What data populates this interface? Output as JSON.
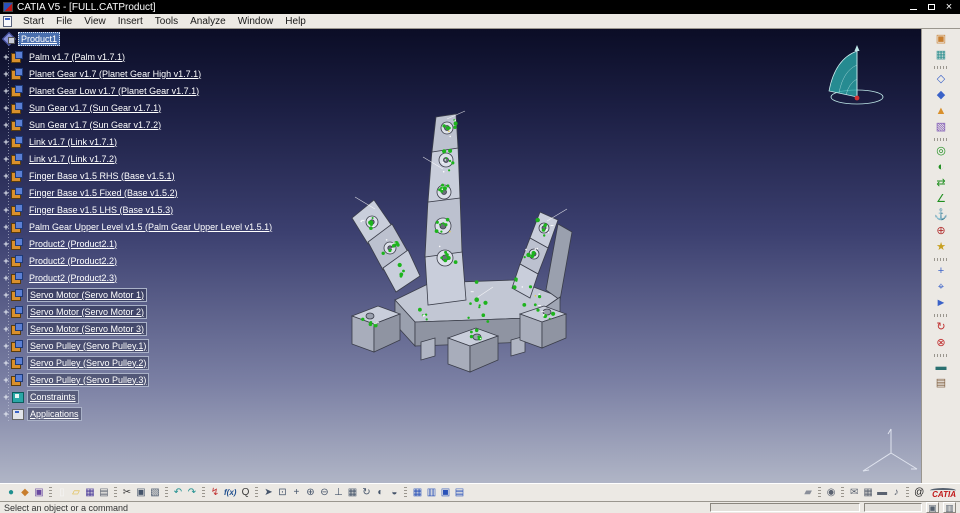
{
  "window": {
    "title": "CATIA V5 - [FULL.CATProduct]"
  },
  "menu": {
    "items": [
      "Start",
      "File",
      "View",
      "Insert",
      "Tools",
      "Analyze",
      "Window",
      "Help"
    ]
  },
  "tree": {
    "expander_glyph": "+",
    "root": {
      "label": "Product1",
      "selected": true
    },
    "items": [
      {
        "label": "Palm v1.7 (Palm v1.7.1)"
      },
      {
        "label": "Planet Gear v1.7 (Planet Gear High v1.7.1)"
      },
      {
        "label": "Planet Gear Low v1.7 (Planet Gear v1.7.1)"
      },
      {
        "label": "Sun Gear v1.7 (Sun Gear v1.7.1)"
      },
      {
        "label": "Sun Gear v1.7 (Sun Gear v1.7.2)"
      },
      {
        "label": "Link v1.7 (Link v1.7.1)"
      },
      {
        "label": "Link v1.7 (Link v1.7.2)"
      },
      {
        "label": "Finger Base v1.5 RHS (Base v1.5.1)"
      },
      {
        "label": "Finger Base v1.5 Fixed (Base v1.5.2)"
      },
      {
        "label": "Finger Base v1.5 LHS (Base v1.5.3)"
      },
      {
        "label": "Palm Gear Upper Level v1.5 (Palm Gear Upper Level v1.5.1)"
      },
      {
        "label": "Product2 (Product2.1)"
      },
      {
        "label": "Product2 (Product2.2)"
      },
      {
        "label": "Product2 (Product2.3)"
      },
      {
        "label": "Servo Motor (Servo Motor 1)",
        "boxed": true
      },
      {
        "label": "Servo Motor (Servo Motor 2)",
        "boxed": true
      },
      {
        "label": "Servo Motor (Servo Motor 3)",
        "boxed": true
      },
      {
        "label": "Servo Pulley (Servo Pulley.1)",
        "boxed": true
      },
      {
        "label": "Servo Pulley (Servo Pulley.2)",
        "boxed": true
      },
      {
        "label": "Servo Pulley (Servo Pulley.3)",
        "boxed": true
      },
      {
        "label": "Constraints",
        "type": "constraints",
        "boxed": true
      },
      {
        "label": "Applications",
        "type": "applications",
        "boxed": true
      }
    ]
  },
  "right_toolbar": {
    "icons": [
      {
        "name": "sticky-pad-icon",
        "glyph": "▣",
        "color": "#c87e2e"
      },
      {
        "name": "camera-window-icon",
        "glyph": "▦",
        "color": "#2a8f8f"
      },
      {
        "sep": true
      },
      {
        "name": "component-icon",
        "glyph": "◇",
        "color": "#3a62c8"
      },
      {
        "name": "product-icon",
        "glyph": "◆",
        "color": "#3a62c8"
      },
      {
        "name": "part-icon",
        "glyph": "▲",
        "color": "#d9902c"
      },
      {
        "name": "existing-component-icon",
        "glyph": "▧",
        "color": "#7a52b4"
      },
      {
        "sep": true
      },
      {
        "name": "coincidence-constraint-icon",
        "glyph": "◎",
        "color": "#1f8f1f"
      },
      {
        "name": "contact-constraint-icon",
        "glyph": "◐",
        "color": "#1f8f1f"
      },
      {
        "name": "offset-constraint-icon",
        "glyph": "⇄",
        "color": "#1f8f1f"
      },
      {
        "name": "angle-constraint-icon",
        "glyph": "∠",
        "color": "#1f8f1f"
      },
      {
        "name": "anchor-constraint-icon",
        "glyph": "⚓",
        "color": "#b23030"
      },
      {
        "name": "fix-together-icon",
        "glyph": "⊕",
        "color": "#b23030"
      },
      {
        "name": "quick-constraint-icon",
        "glyph": "★",
        "color": "#c8a020"
      },
      {
        "sep": true
      },
      {
        "name": "manipulation-icon",
        "glyph": "+",
        "color": "#3a62c8"
      },
      {
        "name": "snap-icon",
        "glyph": "⌖",
        "color": "#3a62c8"
      },
      {
        "name": "smart-move-icon",
        "glyph": "►",
        "color": "#3a62c8"
      },
      {
        "sep": true
      },
      {
        "name": "update-assembly-icon",
        "glyph": "↻",
        "color": "#c03030"
      },
      {
        "name": "clash-analysis-icon",
        "glyph": "⊗",
        "color": "#c03030"
      },
      {
        "sep": true
      },
      {
        "name": "measure-icon",
        "glyph": "▬",
        "color": "#2a7070"
      },
      {
        "name": "annotations-icon",
        "glyph": "▤",
        "color": "#806040"
      }
    ]
  },
  "bottom_toolbar": {
    "logo": "CATIA",
    "left_icons": [
      {
        "name": "workbench-icon",
        "glyph": "●",
        "color": "#1f8f8f"
      },
      {
        "name": "macros-icon",
        "glyph": "◆",
        "color": "#c87e2e"
      },
      {
        "name": "options-icon",
        "glyph": "▣",
        "color": "#6a4aa0"
      },
      {
        "sep": true
      },
      {
        "name": "new-document-icon",
        "glyph": "▯",
        "color": "#f5f5f5"
      },
      {
        "name": "open-document-icon",
        "glyph": "▱",
        "color": "#e0b83a"
      },
      {
        "name": "save-icon",
        "glyph": "▦",
        "color": "#4a3a9a"
      },
      {
        "name": "print-icon",
        "glyph": "▤",
        "color": "#5a6270"
      },
      {
        "sep": true
      },
      {
        "name": "cut-icon",
        "glyph": "✂",
        "color": "#3a3a3a"
      },
      {
        "name": "copy-icon",
        "glyph": "▣",
        "color": "#45546a"
      },
      {
        "name": "paste-icon",
        "glyph": "▧",
        "color": "#45546a"
      },
      {
        "sep": true
      },
      {
        "name": "undo-icon",
        "glyph": "↶",
        "color": "#1f8f8f"
      },
      {
        "name": "redo-icon",
        "glyph": "↷",
        "color": "#1f8f8f"
      },
      {
        "sep": true
      },
      {
        "name": "update-icon",
        "glyph": "↯",
        "color": "#c03030"
      },
      {
        "name": "knowledge-fx-icon",
        "glyph": "f(x)",
        "color": "#1f4f8f",
        "wide": true
      },
      {
        "name": "search-icon",
        "glyph": "Q",
        "color": "#3a3a3a"
      },
      {
        "sep": true
      },
      {
        "name": "fly-mode-icon",
        "glyph": "➤",
        "color": "#45546a"
      },
      {
        "name": "fit-all-icon",
        "glyph": "⊡",
        "color": "#45546a"
      },
      {
        "name": "pan-icon",
        "glyph": "+",
        "color": "#45546a"
      },
      {
        "name": "zoom-in-icon",
        "glyph": "⊕",
        "color": "#45546a"
      },
      {
        "name": "zoom-out-icon",
        "glyph": "⊖",
        "color": "#45546a"
      },
      {
        "name": "normal-view-icon",
        "glyph": "⊥",
        "color": "#45546a"
      },
      {
        "name": "multi-view-icon",
        "glyph": "▦",
        "color": "#45546a"
      },
      {
        "name": "rotate-view-icon",
        "glyph": "↻",
        "color": "#45546a"
      },
      {
        "name": "shading-mode-icon",
        "glyph": "◐",
        "color": "#45546a"
      },
      {
        "name": "hide-show-icon",
        "glyph": "◒",
        "color": "#45546a"
      },
      {
        "sep": true
      },
      {
        "name": "grid-icon",
        "glyph": "▦",
        "color": "#2a52b8"
      },
      {
        "name": "views-icon",
        "glyph": "▥",
        "color": "#2a52b8"
      },
      {
        "name": "capture-icon",
        "glyph": "▣",
        "color": "#2a52b8"
      },
      {
        "name": "render-style-icon",
        "glyph": "▤",
        "color": "#2a52b8"
      }
    ],
    "right_icons": [
      {
        "name": "eraser-icon",
        "glyph": "▰",
        "color": "#8a8f9a"
      },
      {
        "sep": true
      },
      {
        "name": "web-icon",
        "glyph": "◉",
        "color": "#5a6270"
      },
      {
        "sep": true
      },
      {
        "name": "mail-icon",
        "glyph": "✉",
        "color": "#5a6270"
      },
      {
        "name": "storage-icon",
        "glyph": "▦",
        "color": "#5a6270"
      },
      {
        "name": "measure-tool-icon",
        "glyph": "▬",
        "color": "#5a6270"
      },
      {
        "name": "collaboration-icon",
        "glyph": "♪",
        "color": "#5a6270"
      },
      {
        "sep": true
      },
      {
        "name": "at-icon",
        "glyph": "@",
        "color": "#1a1a1a"
      }
    ]
  },
  "status_bar": {
    "message": "Select an object or a command"
  },
  "colors": {
    "selection_blue": "#4a6fae",
    "constraint_green": "#1db41d",
    "viewport_top": "#0b0d26",
    "viewport_bottom": "#b0b5c6",
    "compass_teal": "#2aa7a7"
  }
}
